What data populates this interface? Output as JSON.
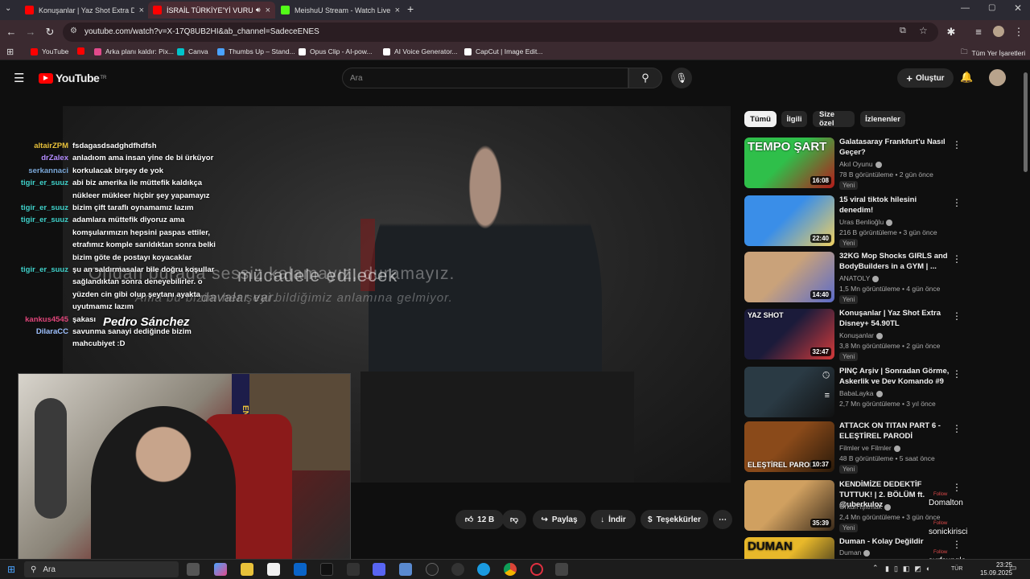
{
  "tabs": [
    {
      "title": "Konuşanlar | Yaz Shot Extra Disney+",
      "favicon_color": "#ff0000"
    },
    {
      "title": "İSRAİL TÜRKİYE'Yİ VURUR MU",
      "favicon_color": "#ff0000",
      "active": true
    },
    {
      "title": "MeishuU Stream - Watch Live on Kick",
      "favicon_color": "#53fc18"
    }
  ],
  "url": "youtube.com/watch?v=X-17Q8UB2HI&ab_channel=SadeceENES",
  "bookmarks": [
    {
      "label": "YouTube",
      "color": "#ff0000"
    },
    {
      "label": "",
      "color": "#ff0000"
    },
    {
      "label": "Arka planı kaldır: Pix...",
      "color": "#e24a8b"
    },
    {
      "label": "Canva",
      "color": "#00c4cc"
    },
    {
      "label": "Thumbs Up – Stand...",
      "color": "#4aa3ff"
    },
    {
      "label": "Opus Clip - AI-pow...",
      "color": "#ffffff"
    },
    {
      "label": "AI Voice Generator...",
      "color": "#ffffff"
    },
    {
      "label": "CapCut | Image Edit...",
      "color": "#ffffff"
    }
  ],
  "all_bookmarks": "Tüm Yer İşaretleri",
  "yt": {
    "logo": "YouTube",
    "logo_sup": "TR",
    "search_placeholder": "Ara",
    "create": "Oluştur"
  },
  "video": {
    "subtitle_line1": "mücadele edilecek",
    "subtitle_line2": "davalar var.",
    "ghost_line1": "Ondan burada sessiz kalamayız, duramayız.",
    "ghost_line2": "Ama bu bizim her şeyi bildiğimiz anlamına gelmiyor."
  },
  "chat": [
    {
      "name": "altairZPM",
      "color": "#e8c13a",
      "lines": [
        "fsdagasdsadghdfhdfsh"
      ]
    },
    {
      "name": "drZalex",
      "color": "#b48cff",
      "lines": [
        "anladıom ama insan yine de bi ürküyor"
      ]
    },
    {
      "name": "serkannaci",
      "color": "#7aa7d8",
      "lines": [
        "korkulacak birşey de yok"
      ]
    },
    {
      "name": "tigir_er_suuz",
      "color": "#3fd0c9",
      "lines": [
        "abi biz amerika ile müttefik kaldıkça",
        "nükleer mükleer hiçbir şey yapamayız"
      ]
    },
    {
      "name": "tigir_er_suuz",
      "color": "#3fd0c9",
      "lines": [
        "bizim çift taraflı oynamamız lazım"
      ]
    },
    {
      "name": "tigir_er_suuz",
      "color": "#3fd0c9",
      "lines": [
        "adamlara müttefik diyoruz ama",
        "komşularımızın hepsini paspas ettiler,",
        "etrafımız komple sarıldıktan sonra belki",
        "bizim göte de postayı koyacaklar"
      ]
    },
    {
      "name": "tigir_er_suuz",
      "color": "#3fd0c9",
      "lines": [
        "şu an saldırmasalar bile doğru koşullar",
        "sağlandıktan sonra deneyebilirler. o",
        "yüzden cin gibi olup şeytanı ayakta",
        "uyutmamız lazım"
      ]
    },
    {
      "name": "kankus4545",
      "color": "#e0457a",
      "lines": [
        "şakası"
      ]
    },
    {
      "name": "DilaraCC",
      "color": "#9ec1ff",
      "lines": [
        "savunma sanayi dediğinde bizim",
        "mahcubiyet :D"
      ]
    }
  ],
  "speaker_name": "Pedro Sánchez",
  "webcam_banner": "ENERBA",
  "actions": {
    "likes": "12 B",
    "share": "Paylaş",
    "download": "İndir",
    "thanks": "Teşekkürler"
  },
  "chips": [
    {
      "label": "Tümü",
      "active": true
    },
    {
      "label": "İlgili"
    },
    {
      "label": "Size özel"
    },
    {
      "label": "İzlenenler"
    }
  ],
  "recs": [
    {
      "title": "Galatasaray Frankfurt'u Nasıl Geçer?",
      "channel": "Akıl Oyunu",
      "meta": "78 B görüntüleme • 2 gün önce",
      "badge": "Yeni",
      "duration": "16:08",
      "thumb_text": "TEMPO ŞART",
      "c1": "#2fbf4a",
      "c2": "#b51a1a"
    },
    {
      "title": "15 viral tiktok hilesini denedim!",
      "channel": "Uras Benlioğlu",
      "meta": "216 B görüntüleme • 3 gün önce",
      "badge": "Yeni",
      "duration": "22:40",
      "thumb_text": "",
      "c1": "#3a8ee8",
      "c2": "#f0d060"
    },
    {
      "title": "32KG Mop Shocks GIRLS and BodyBuilders in a GYM | ...",
      "channel": "ANATOLY",
      "meta": "1,5 Mn görüntüleme • 4 gün önce",
      "badge": "Yeni",
      "duration": "14:40",
      "thumb_text": "",
      "c1": "#c9a27a",
      "c2": "#5b6bc9"
    },
    {
      "title": "Konuşanlar | Yaz Shot Extra Disney+ 54.90TL",
      "channel": "Konuşanlar",
      "meta": "3,8 Mn görüntüleme • 2 gün önce",
      "badge": "Yeni",
      "duration": "32:47",
      "thumb_text": "YAZ SHOT",
      "c1": "#1b1b3a",
      "c2": "#d43a3a"
    },
    {
      "title": "PINÇ Arşiv | Sonradan Görme, Askerlik ve Dev Komando #9",
      "channel": "BabaLayka",
      "meta": "2,7 Mn görüntüleme • 3 yıl önce",
      "badge": "",
      "duration": "",
      "thumb_text": "",
      "c1": "#2a3a44",
      "c2": "#111"
    },
    {
      "title": "ATTACK ON TITAN PART 6 - ELEŞTİREL PARODİ",
      "channel": "Filmler ve Filmler",
      "meta": "48 B görüntüleme • 5 saat önce",
      "badge": "Yeni",
      "duration": "10:37",
      "thumb_text": "ELEŞTİREL PARODİ",
      "c1": "#8a4a1a",
      "c2": "#2a1a0a"
    },
    {
      "title": "KENDİMİZE DEDEKTİF TUTTUK! | 2. BÖLÜM ft. @uberkuloz",
      "channel": "Orkun Işıtmak",
      "meta": "2,4 Mn görüntüleme • 3 gün önce",
      "badge": "Yeni",
      "duration": "35:39",
      "thumb_text": "",
      "c1": "#d0a060",
      "c2": "#3a2a1a"
    },
    {
      "title": "Duman - Kolay Değildir",
      "channel": "Duman",
      "meta": "",
      "badge": "",
      "duration": "",
      "thumb_text": "DUMAN",
      "c1": "#e8b82a",
      "c2": "#1a1a1a"
    }
  ],
  "followers": [
    {
      "badge": "Follow",
      "name": "Domalton"
    },
    {
      "badge": "Follow",
      "name": "sonickirisci"
    },
    {
      "badge": "Follow",
      "name": "surfsungle"
    }
  ],
  "taskbar": {
    "search": "Ara",
    "time": "23:25",
    "date": "15.09.2025",
    "lang": "TÜR"
  }
}
